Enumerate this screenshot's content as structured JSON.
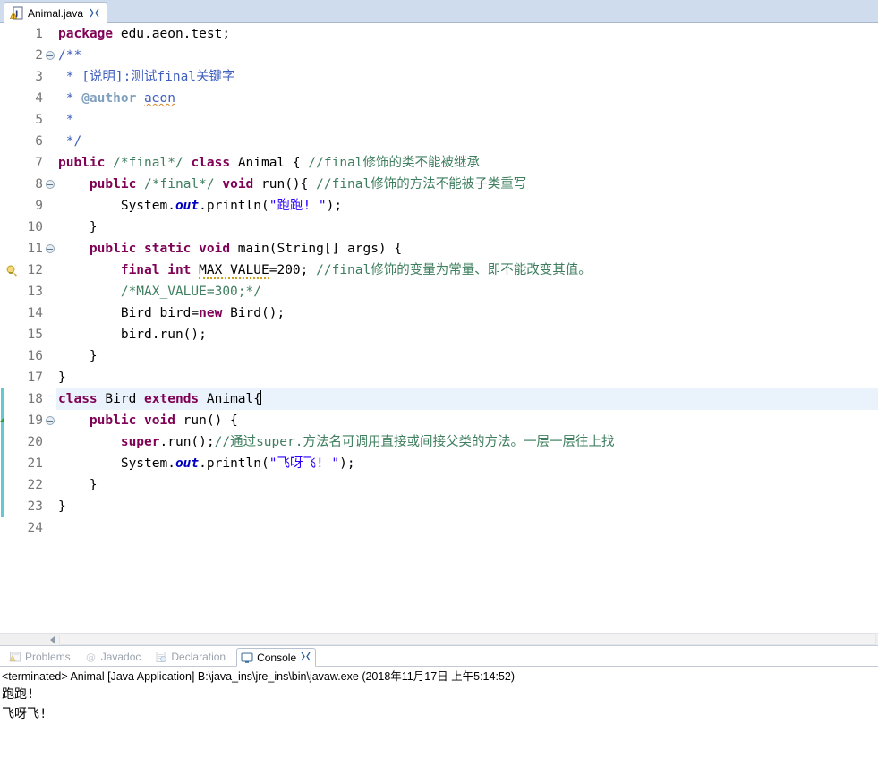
{
  "editor_tab": {
    "label": "Animal.java",
    "icon": "java-file-warning-icon",
    "close_icon": "close-icon"
  },
  "code": {
    "current_line": 18,
    "fold_lines": [
      2,
      8,
      11,
      19
    ],
    "warning_line": 12,
    "change_bar_lines": [
      18,
      19,
      20,
      21,
      22,
      23
    ],
    "line_numbers": [
      "1",
      "2",
      "3",
      "4",
      "5",
      "6",
      "7",
      "8",
      "9",
      "10",
      "11",
      "12",
      "13",
      "14",
      "15",
      "16",
      "17",
      "18",
      "19",
      "20",
      "21",
      "22",
      "23",
      "24"
    ],
    "lines": [
      {
        "n": 1,
        "tokens": [
          {
            "t": "kw",
            "v": "package"
          },
          {
            "t": "plain",
            "v": " edu.aeon.test;"
          }
        ]
      },
      {
        "n": 2,
        "tokens": [
          {
            "t": "jdoc",
            "v": "/**"
          }
        ]
      },
      {
        "n": 3,
        "tokens": [
          {
            "t": "jdoc",
            "v": " * [说明]:测试final关键字"
          }
        ]
      },
      {
        "n": 4,
        "tokens": [
          {
            "t": "jdoc",
            "v": " * "
          },
          {
            "t": "jtag",
            "v": "@author"
          },
          {
            "t": "jdoc",
            "v": " "
          },
          {
            "t": "jdoc-spell",
            "v": "aeon"
          }
        ]
      },
      {
        "n": 5,
        "tokens": [
          {
            "t": "jdoc",
            "v": " *"
          }
        ]
      },
      {
        "n": 6,
        "tokens": [
          {
            "t": "jdoc",
            "v": " */"
          }
        ]
      },
      {
        "n": 7,
        "tokens": [
          {
            "t": "kw",
            "v": "public"
          },
          {
            "t": "plain",
            "v": " "
          },
          {
            "t": "cmt",
            "v": "/*final*/"
          },
          {
            "t": "plain",
            "v": " "
          },
          {
            "t": "kw",
            "v": "class"
          },
          {
            "t": "plain",
            "v": " Animal { "
          },
          {
            "t": "cmt",
            "v": "//final修饰的类不能被继承"
          }
        ]
      },
      {
        "n": 8,
        "tokens": [
          {
            "t": "plain",
            "v": "    "
          },
          {
            "t": "kw",
            "v": "public"
          },
          {
            "t": "plain",
            "v": " "
          },
          {
            "t": "cmt",
            "v": "/*final*/"
          },
          {
            "t": "plain",
            "v": " "
          },
          {
            "t": "kw",
            "v": "void"
          },
          {
            "t": "plain",
            "v": " run(){ "
          },
          {
            "t": "cmt",
            "v": "//final修饰的方法不能被子类重写"
          }
        ]
      },
      {
        "n": 9,
        "tokens": [
          {
            "t": "plain",
            "v": "        System."
          },
          {
            "t": "fld",
            "v": "out"
          },
          {
            "t": "plain",
            "v": ".println("
          },
          {
            "t": "str",
            "v": "\"跑跑! \""
          },
          {
            "t": "plain",
            "v": ");"
          }
        ]
      },
      {
        "n": 10,
        "tokens": [
          {
            "t": "plain",
            "v": "    }"
          }
        ]
      },
      {
        "n": 11,
        "tokens": [
          {
            "t": "plain",
            "v": "    "
          },
          {
            "t": "kw",
            "v": "public static void"
          },
          {
            "t": "plain",
            "v": " main(String[] args) {"
          }
        ]
      },
      {
        "n": 12,
        "tokens": [
          {
            "t": "plain",
            "v": "        "
          },
          {
            "t": "kw",
            "v": "final int"
          },
          {
            "t": "plain",
            "v": " "
          },
          {
            "t": "warn",
            "v": "MAX_VALUE"
          },
          {
            "t": "plain",
            "v": "=200; "
          },
          {
            "t": "cmt",
            "v": "//final修饰的变量为常量、即不能改变其值。"
          }
        ]
      },
      {
        "n": 13,
        "tokens": [
          {
            "t": "plain",
            "v": "        "
          },
          {
            "t": "cmt",
            "v": "/*MAX_VALUE=300;*/"
          }
        ]
      },
      {
        "n": 14,
        "tokens": [
          {
            "t": "plain",
            "v": "        Bird bird="
          },
          {
            "t": "kw",
            "v": "new"
          },
          {
            "t": "plain",
            "v": " Bird();"
          }
        ]
      },
      {
        "n": 15,
        "tokens": [
          {
            "t": "plain",
            "v": "        bird.run();"
          }
        ]
      },
      {
        "n": 16,
        "tokens": [
          {
            "t": "plain",
            "v": "    }"
          }
        ]
      },
      {
        "n": 17,
        "tokens": [
          {
            "t": "plain",
            "v": "}"
          }
        ]
      },
      {
        "n": 18,
        "tokens": [
          {
            "t": "kw",
            "v": "class"
          },
          {
            "t": "plain",
            "v": " Bird "
          },
          {
            "t": "kw",
            "v": "extends"
          },
          {
            "t": "plain",
            "v": " Animal{"
          },
          {
            "t": "caret",
            "v": ""
          }
        ]
      },
      {
        "n": 19,
        "tokens": [
          {
            "t": "plain",
            "v": "    "
          },
          {
            "t": "kw",
            "v": "public void"
          },
          {
            "t": "plain",
            "v": " run() {"
          }
        ]
      },
      {
        "n": 20,
        "tokens": [
          {
            "t": "plain",
            "v": "        "
          },
          {
            "t": "kw",
            "v": "super"
          },
          {
            "t": "plain",
            "v": ".run();"
          },
          {
            "t": "cmt",
            "v": "//通过super.方法名可调用直接或间接父类的方法。一层一层往上找"
          }
        ]
      },
      {
        "n": 21,
        "tokens": [
          {
            "t": "plain",
            "v": "        System."
          },
          {
            "t": "fld",
            "v": "out"
          },
          {
            "t": "plain",
            "v": ".println("
          },
          {
            "t": "str",
            "v": "\"飞呀飞! \""
          },
          {
            "t": "plain",
            "v": ");"
          }
        ]
      },
      {
        "n": 22,
        "tokens": [
          {
            "t": "plain",
            "v": "    }"
          }
        ]
      },
      {
        "n": 23,
        "tokens": [
          {
            "t": "plain",
            "v": "}"
          }
        ]
      },
      {
        "n": 24,
        "tokens": [
          {
            "t": "plain",
            "v": ""
          }
        ]
      }
    ]
  },
  "bottom_tabs": [
    {
      "label": "Problems",
      "icon": "problems-icon",
      "active": false
    },
    {
      "label": "Javadoc",
      "icon": "javadoc-icon",
      "active": false
    },
    {
      "label": "Declaration",
      "icon": "declaration-icon",
      "active": false
    },
    {
      "label": "Console",
      "icon": "console-icon",
      "active": true
    }
  ],
  "console": {
    "header": "<terminated> Animal [Java Application] B:\\java_ins\\jre_ins\\bin\\javaw.exe (2018年11月17日 上午5:14:52)",
    "output": [
      "跑跑!",
      "飞呀飞!"
    ]
  },
  "colors": {
    "keyword": "#7f0055",
    "comment": "#3f7f5f",
    "javadoc": "#3f5fbf",
    "string": "#2a00ff",
    "field": "#0000c0",
    "tab_bar": "#cfdcee",
    "current_line": "#eaf2fb",
    "change_bar": "#64c8d2"
  }
}
